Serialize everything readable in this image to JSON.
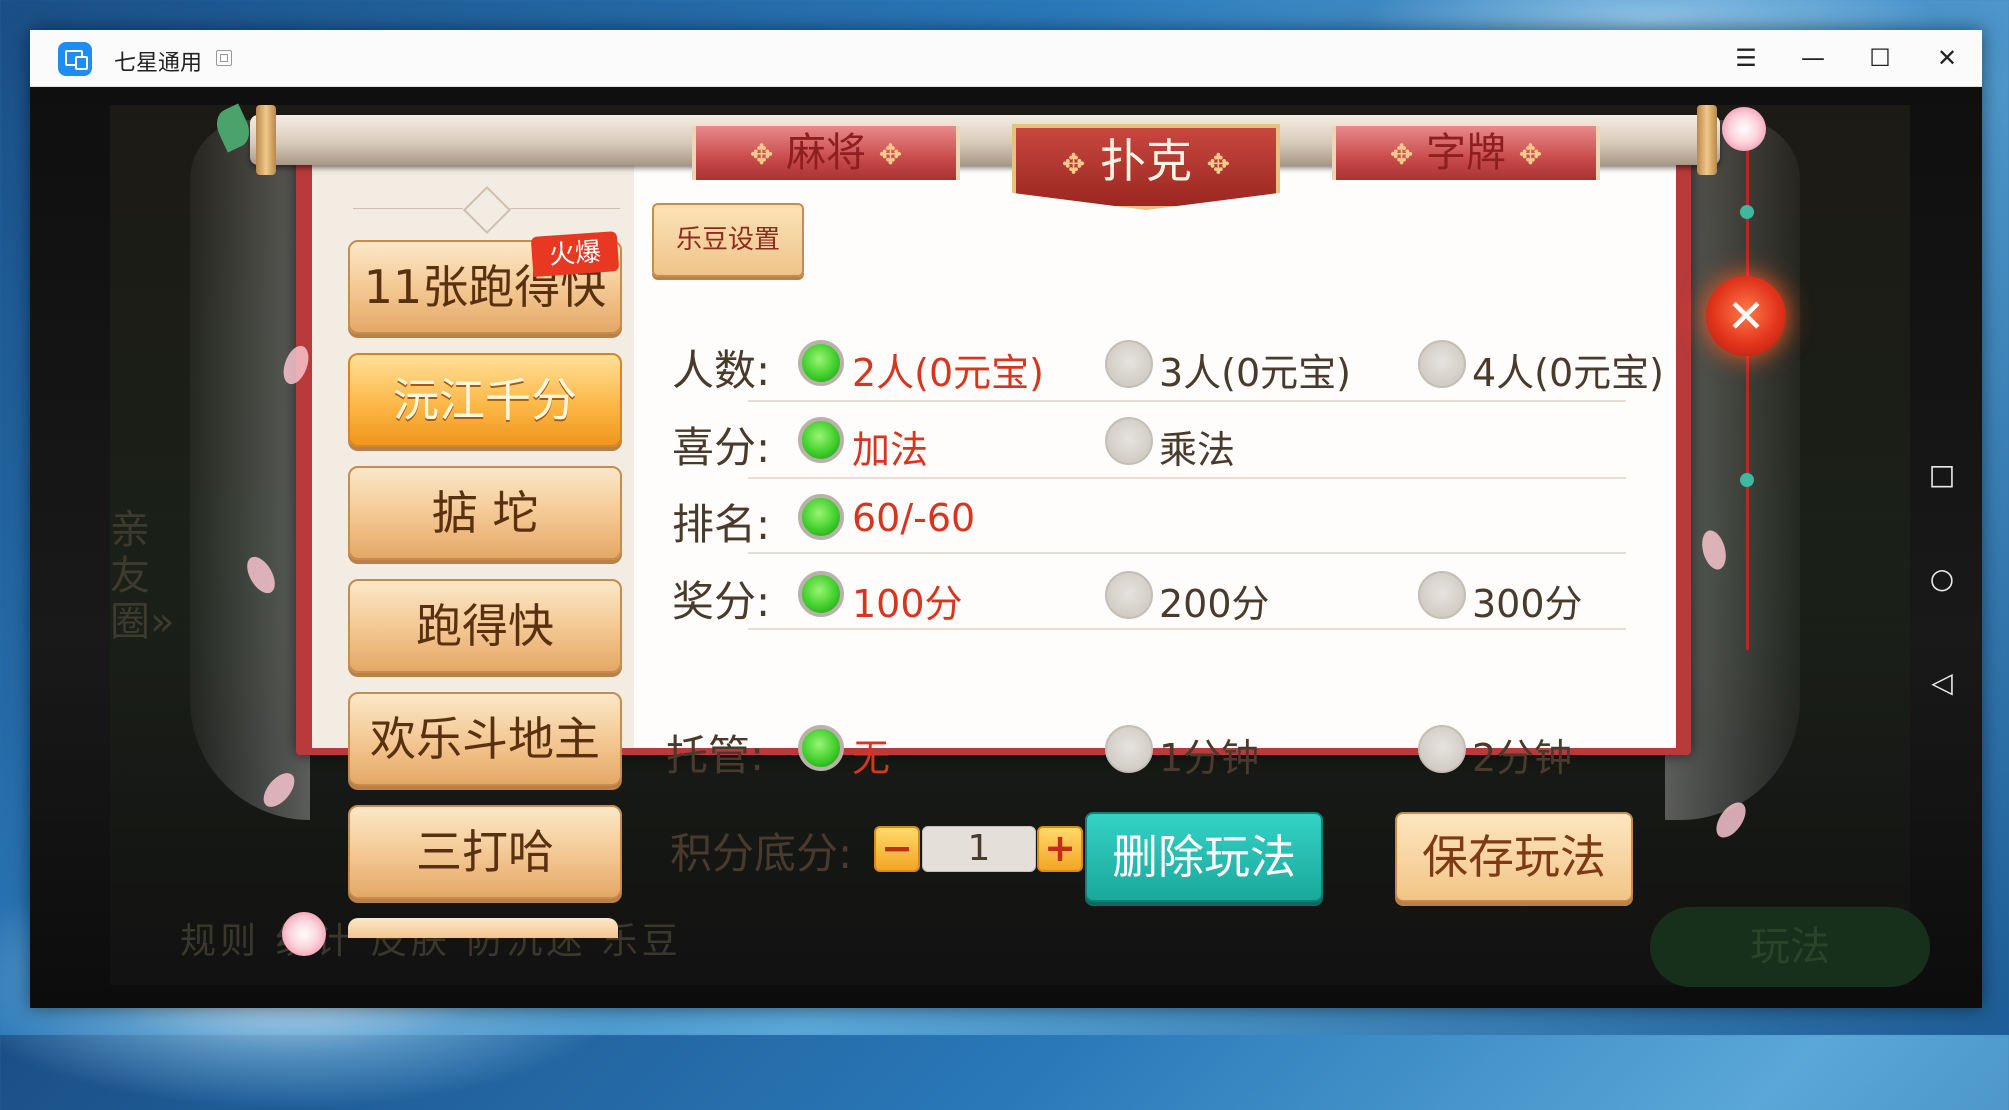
{
  "window": {
    "title": "七星通用",
    "controls": {
      "menu": "☰",
      "minimize": "—",
      "maximize": "☐",
      "close": "✕"
    }
  },
  "tabs": [
    {
      "label": "麻将",
      "active": false
    },
    {
      "label": "扑克",
      "active": true
    },
    {
      "label": "字牌",
      "active": false
    }
  ],
  "sidebar": {
    "hot_badge": "火爆",
    "games": [
      {
        "label": "11张跑得快",
        "active": false
      },
      {
        "label": "沅江千分",
        "active": true
      },
      {
        "label": "掂 坨",
        "active": false
      },
      {
        "label": "跑得快",
        "active": false
      },
      {
        "label": "欢乐斗地主",
        "active": false
      },
      {
        "label": "三打哈",
        "active": false
      }
    ]
  },
  "ledou_button": "乐豆设置",
  "settings": {
    "players": {
      "label": "人数:",
      "options": [
        {
          "text": "2人(0元宝)",
          "selected": true
        },
        {
          "text": "3人(0元宝)",
          "selected": false
        },
        {
          "text": "4人(0元宝)",
          "selected": false
        }
      ]
    },
    "xifen": {
      "label": "喜分:",
      "options": [
        {
          "text": "加法",
          "selected": true
        },
        {
          "text": "乘法",
          "selected": false
        }
      ]
    },
    "ranking": {
      "label": "排名:",
      "options": [
        {
          "text": "60/-60",
          "selected": true
        }
      ]
    },
    "bonus": {
      "label": "奖分:",
      "options": [
        {
          "text": "100分",
          "selected": true
        },
        {
          "text": "200分",
          "selected": false
        },
        {
          "text": "300分",
          "selected": false
        }
      ]
    },
    "trustee": {
      "label": "托管:",
      "options": [
        {
          "text": "无",
          "selected": true
        },
        {
          "text": "1分钟",
          "selected": false
        },
        {
          "text": "2分钟",
          "selected": false
        }
      ]
    },
    "base_score": {
      "label": "积分底分:",
      "minus": "−",
      "value": "1",
      "plus": "+"
    }
  },
  "actions": {
    "delete": "删除玩法",
    "save": "保存玩法"
  },
  "close_lantern": "✕",
  "background": {
    "left_text": "亲友圈»",
    "bottom_text": "规则   统计   皮肤   防沉迷   乐豆",
    "right_button": "玩法"
  },
  "android_nav": {
    "recent": "□",
    "home": "○",
    "back": "◁"
  },
  "colors": {
    "accent_red": "#d7351f",
    "radio_green": "#3fcf2b",
    "delete_teal": "#1aa89a",
    "scroll_red": "#b83a3a"
  }
}
